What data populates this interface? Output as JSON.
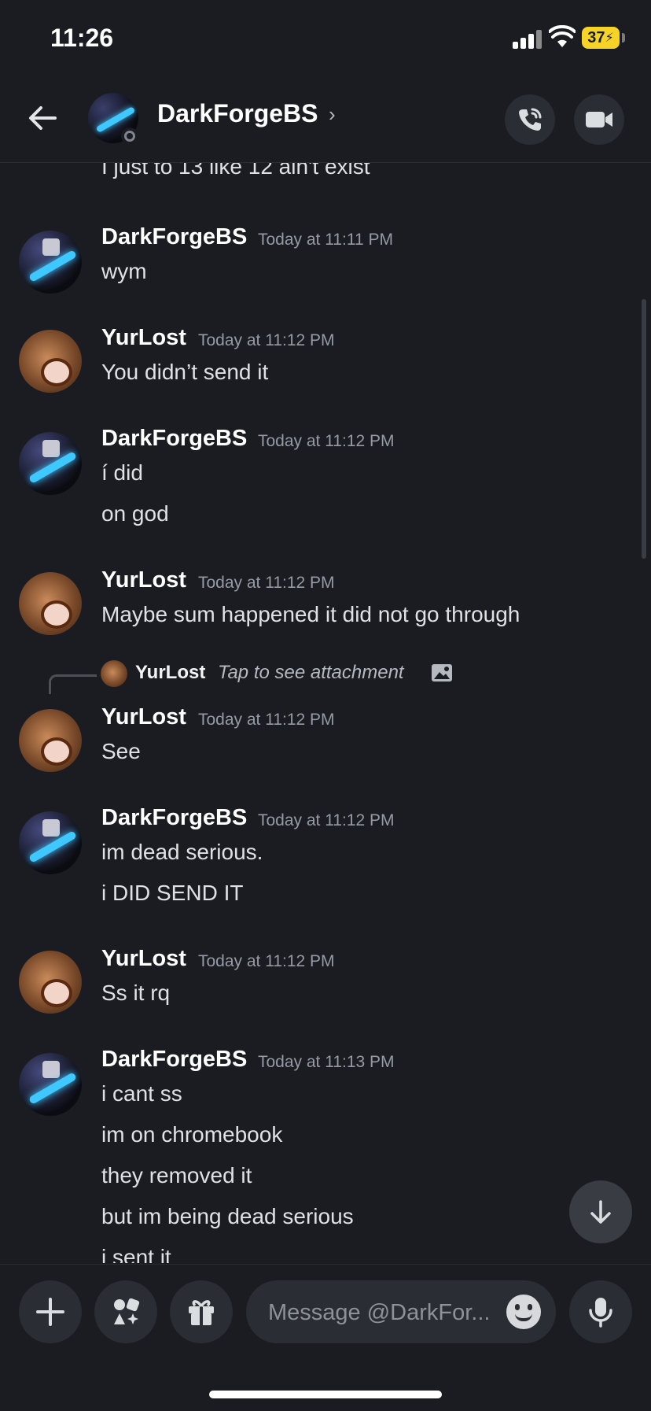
{
  "status_bar": {
    "time": "11:26",
    "battery": "37"
  },
  "header": {
    "name": "DarkForgeBS",
    "chevron": "›"
  },
  "top_partial_text": "I just to 13 like 12 ain't exist",
  "messages": [
    {
      "author": "DarkForgeBS",
      "timestamp": "Today at 11:11 PM",
      "lines": [
        "wym"
      ]
    },
    {
      "author": "YurLost",
      "timestamp": "Today at 11:12 PM",
      "lines": [
        "You didn’t send it"
      ]
    },
    {
      "author": "DarkForgeBS",
      "timestamp": "Today at 11:12 PM",
      "lines": [
        "í did",
        "on god"
      ]
    },
    {
      "author": "YurLost",
      "timestamp": "Today at 11:12 PM",
      "lines": [
        "Maybe sum happened it did not go through"
      ]
    },
    {
      "author": "YurLost",
      "timestamp": "Today at 11:12 PM",
      "lines": [
        "See"
      ]
    },
    {
      "author": "DarkForgeBS",
      "timestamp": "Today at 11:12 PM",
      "lines": [
        "im dead serious.",
        "i DID SEND IT"
      ]
    },
    {
      "author": "YurLost",
      "timestamp": "Today at 11:12 PM",
      "lines": [
        "Ss it rq"
      ]
    },
    {
      "author": "DarkForgeBS",
      "timestamp": "Today at 11:13 PM",
      "lines": [
        "i cant ss",
        "im on chromebook",
        "they removed it",
        "but im being dead serious",
        "i sent it"
      ]
    }
  ],
  "reply_preview": {
    "author": "YurLost",
    "text": "Tap to see attachment"
  },
  "composer": {
    "placeholder": "Message @DarkFor..."
  }
}
